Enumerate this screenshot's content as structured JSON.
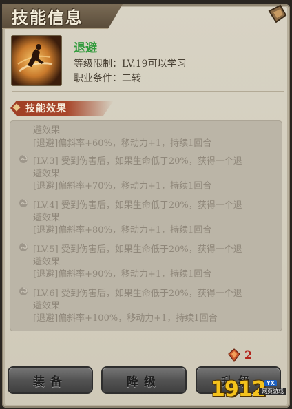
{
  "window": {
    "title": "技能信息"
  },
  "skill": {
    "name": "退避",
    "level_req": "等级限制：LV.19可以学习",
    "job_req": "职业条件：二转",
    "icon": "skill-dodge-icon"
  },
  "effects": {
    "section_label": "技能效果",
    "partial_top": "避效果",
    "lines": [
      {
        "bullet": false,
        "text": "[退避]偏斜率+60%，移动力+1，持续1回合"
      },
      {
        "bullet": true,
        "text": "[LV.3] 受到伤害后，如果生命低于20%，获得一个退"
      },
      {
        "bullet": false,
        "text": "避效果"
      },
      {
        "bullet": false,
        "text": "[退避]偏斜率+70%，移动力+1，持续1回合"
      },
      {
        "bullet": true,
        "text": "[LV.4] 受到伤害后，如果生命低于20%，获得一个退"
      },
      {
        "bullet": false,
        "text": "避效果"
      },
      {
        "bullet": false,
        "text": "[退避]偏斜率+80%，移动力+1，持续1回合"
      },
      {
        "bullet": true,
        "text": "[LV.5] 受到伤害后，如果生命低于20%，获得一个退"
      },
      {
        "bullet": false,
        "text": "避效果"
      },
      {
        "bullet": false,
        "text": "[退避]偏斜率+90%，移动力+1，持续1回合"
      },
      {
        "bullet": true,
        "text": "[LV.6] 受到伤害后，如果生命低于20%，获得一个退"
      },
      {
        "bullet": false,
        "text": "避效果"
      },
      {
        "bullet": false,
        "text": "[退避]偏斜率+100%，移动力+1，持续1回合"
      }
    ]
  },
  "cost": {
    "count": "2",
    "icon": "gem-icon"
  },
  "buttons": {
    "equip": "装备",
    "downgrade": "降级",
    "upgrade": "升级"
  },
  "watermark": {
    "number": "1912",
    "tag": "YX",
    "sub": "网页游戏"
  },
  "colors": {
    "skill_name": "#2f9a3a",
    "section_tab": "#a8472b",
    "cost": "#b3231b"
  }
}
